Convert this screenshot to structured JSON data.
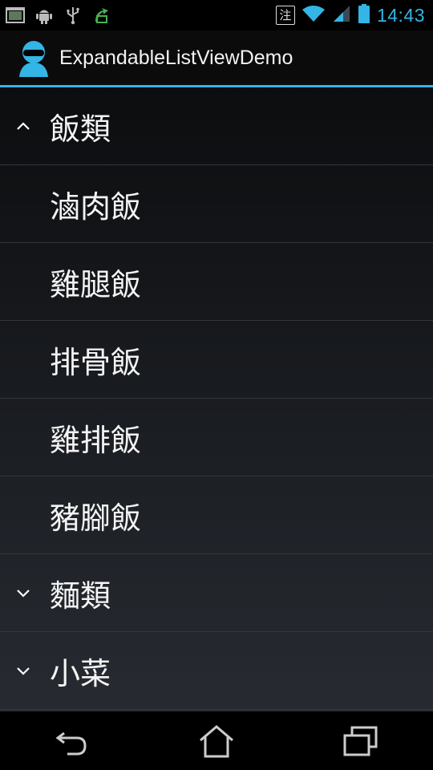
{
  "status_bar": {
    "ime_label": "注",
    "time": "14:43",
    "icons": [
      "screenshot-icon",
      "android-debug-icon",
      "usb-icon",
      "recycle-icon",
      "wifi-icon",
      "signal-icon",
      "battery-icon"
    ]
  },
  "action_bar": {
    "title": "ExpandableListViewDemo",
    "app_icon": "person-icon"
  },
  "list": {
    "groups": [
      {
        "label": "飯類",
        "expanded": true
      },
      {
        "label": "麵類",
        "expanded": false
      },
      {
        "label": "小菜",
        "expanded": false
      }
    ],
    "rice_items": [
      "滷肉飯",
      "雞腿飯",
      "排骨飯",
      "雞排飯",
      "豬腳飯"
    ]
  },
  "nav_bar": {
    "icons": [
      "back-icon",
      "home-icon",
      "recent-apps-icon"
    ]
  },
  "colors": {
    "accent": "#33b5e5",
    "background": "#000000",
    "divider": "#33363b"
  }
}
